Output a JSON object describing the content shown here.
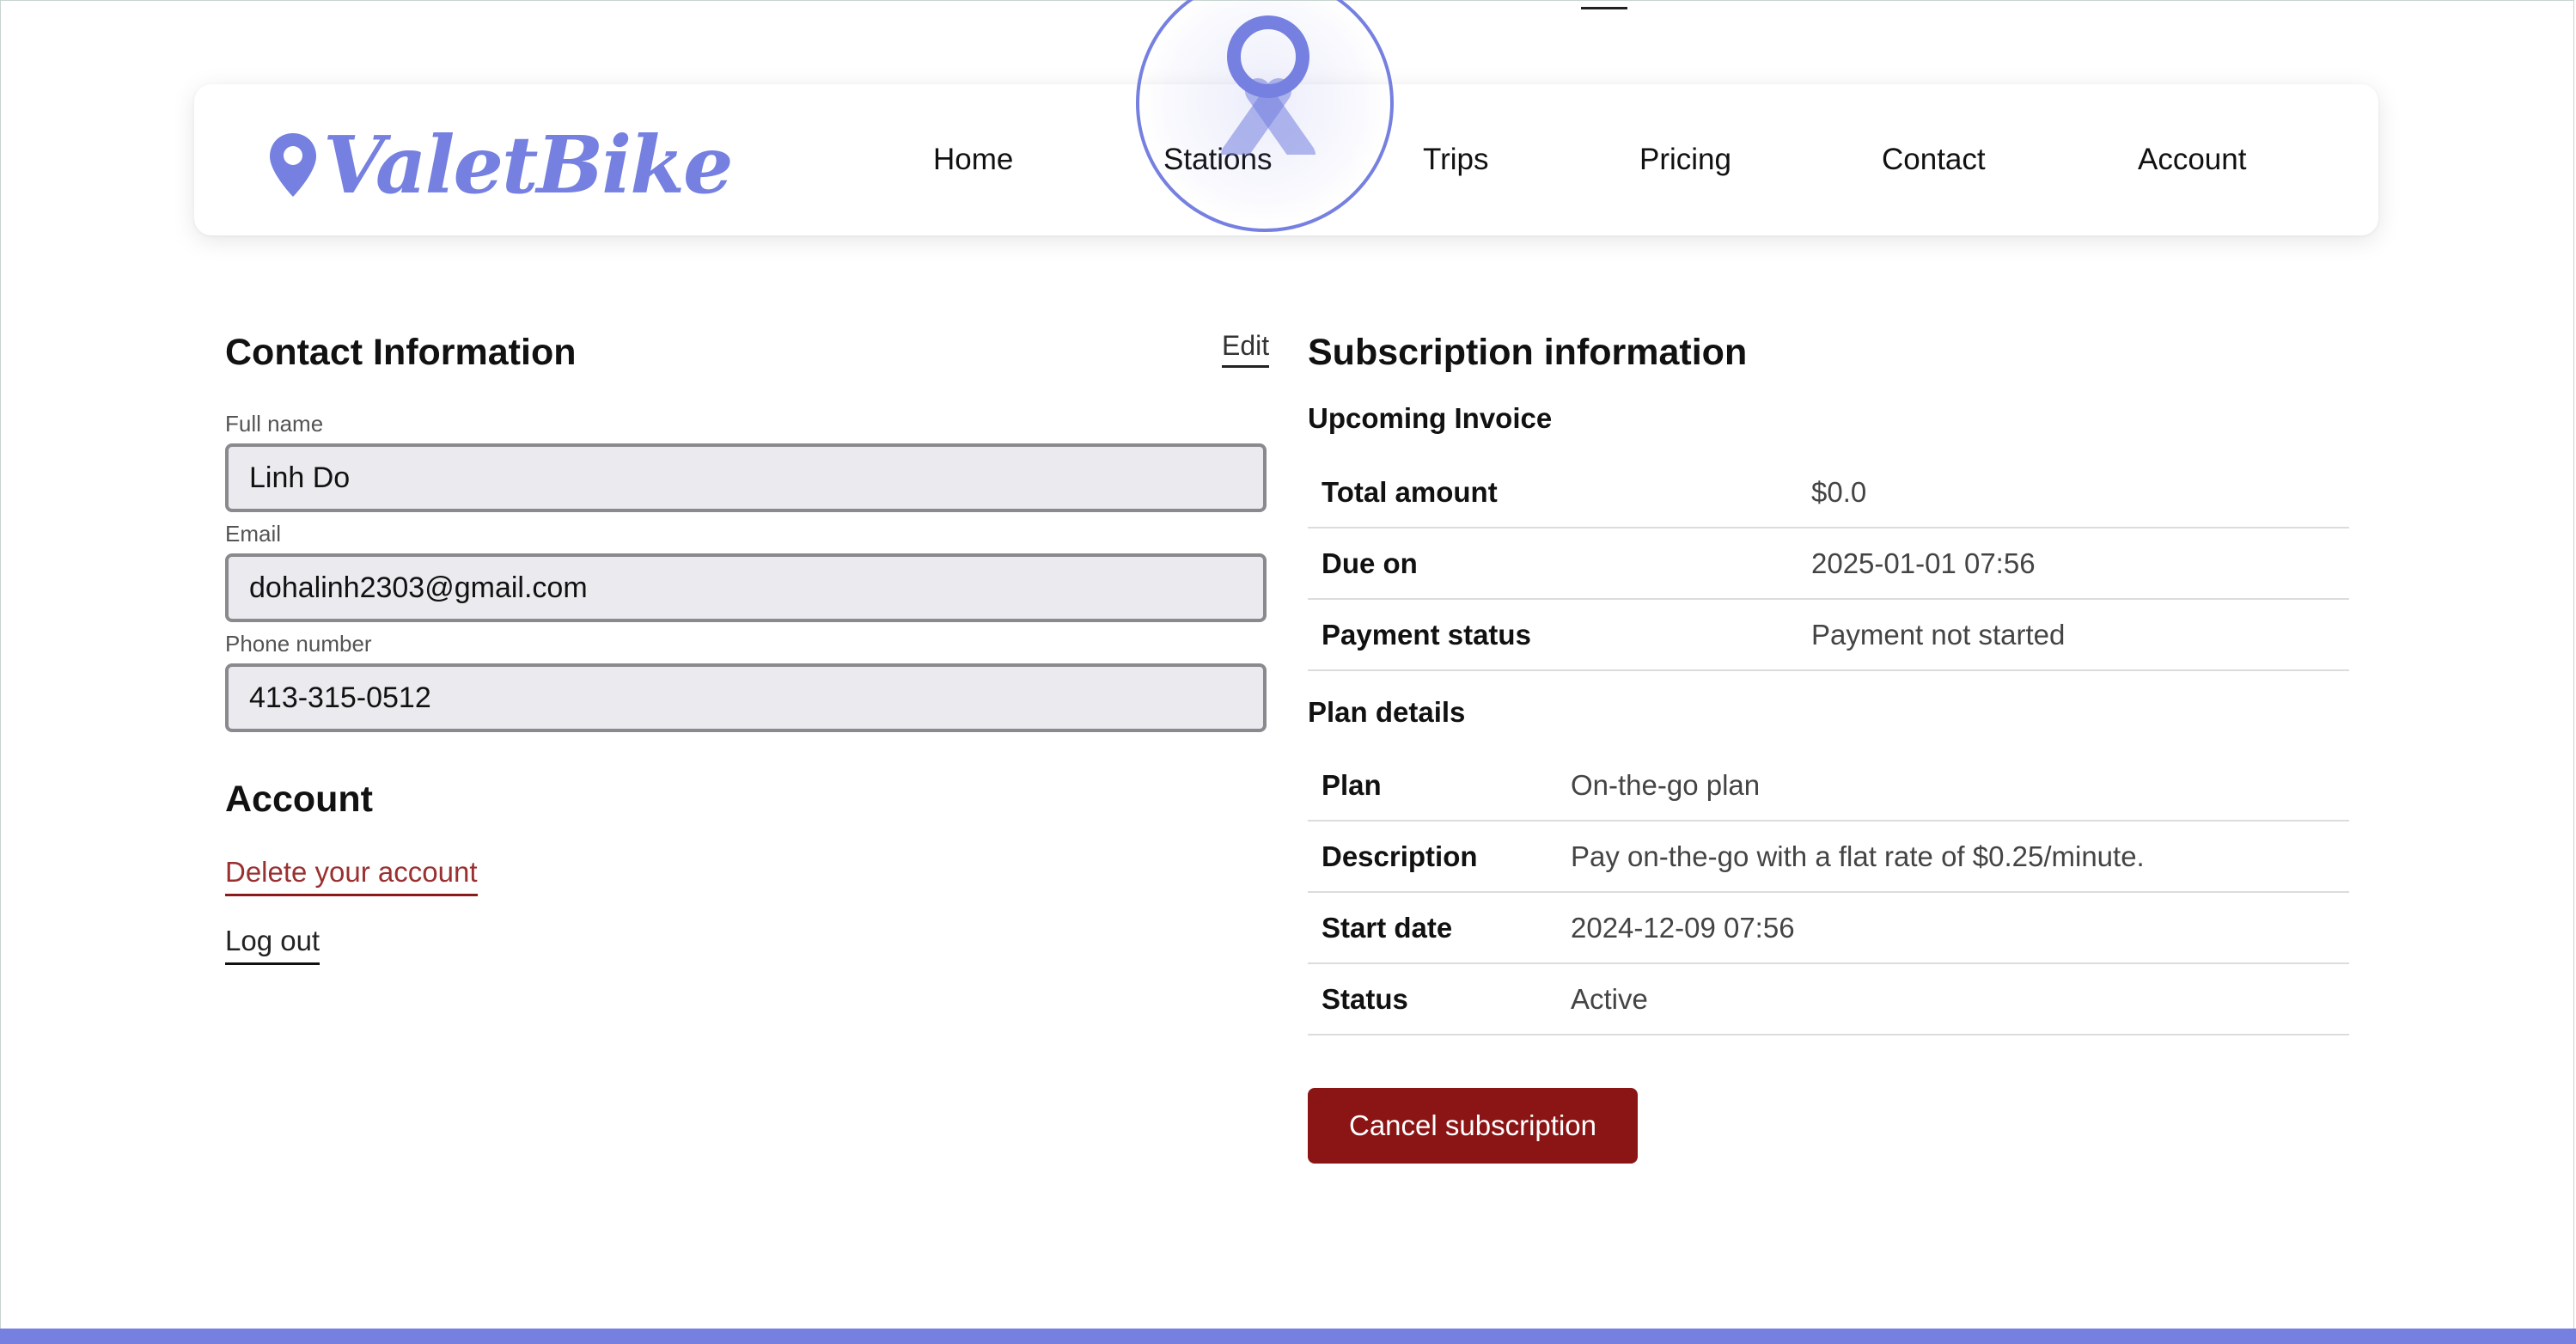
{
  "brand": {
    "name": "ValetBike",
    "color": "#7580e0"
  },
  "nav": {
    "items": [
      "Home",
      "Stations",
      "Trips",
      "Pricing",
      "Contact",
      "Account"
    ]
  },
  "contact": {
    "title": "Contact Information",
    "edit_label": "Edit",
    "fields": {
      "full_name": {
        "label": "Full name",
        "value": "Linh Do"
      },
      "email": {
        "label": "Email",
        "value": "dohalinh2303@gmail.com"
      },
      "phone": {
        "label": "Phone number",
        "value": "413-315-0512"
      }
    }
  },
  "account": {
    "title": "Account",
    "delete_label": "Delete your account",
    "logout_label": "Log out"
  },
  "subscription": {
    "title": "Subscription information",
    "invoice": {
      "heading": "Upcoming Invoice",
      "rows": [
        {
          "label": "Total amount",
          "value": "$0.0"
        },
        {
          "label": "Due on",
          "value": "2025-01-01 07:56"
        },
        {
          "label": "Payment status",
          "value": "Payment not started"
        }
      ]
    },
    "plan": {
      "heading": "Plan details",
      "rows": [
        {
          "label": "Plan",
          "value": "On-the-go plan"
        },
        {
          "label": "Description",
          "value": "Pay on-the-go with a flat rate of $0.25/minute."
        },
        {
          "label": "Start date",
          "value": "2024-12-09 07:56"
        },
        {
          "label": "Status",
          "value": "Active"
        }
      ]
    },
    "cancel_label": "Cancel subscription",
    "cancel_color": "#8b1414"
  },
  "icons": {
    "brand": "map-pin-icon",
    "cursor": "user-cursor-icon"
  }
}
